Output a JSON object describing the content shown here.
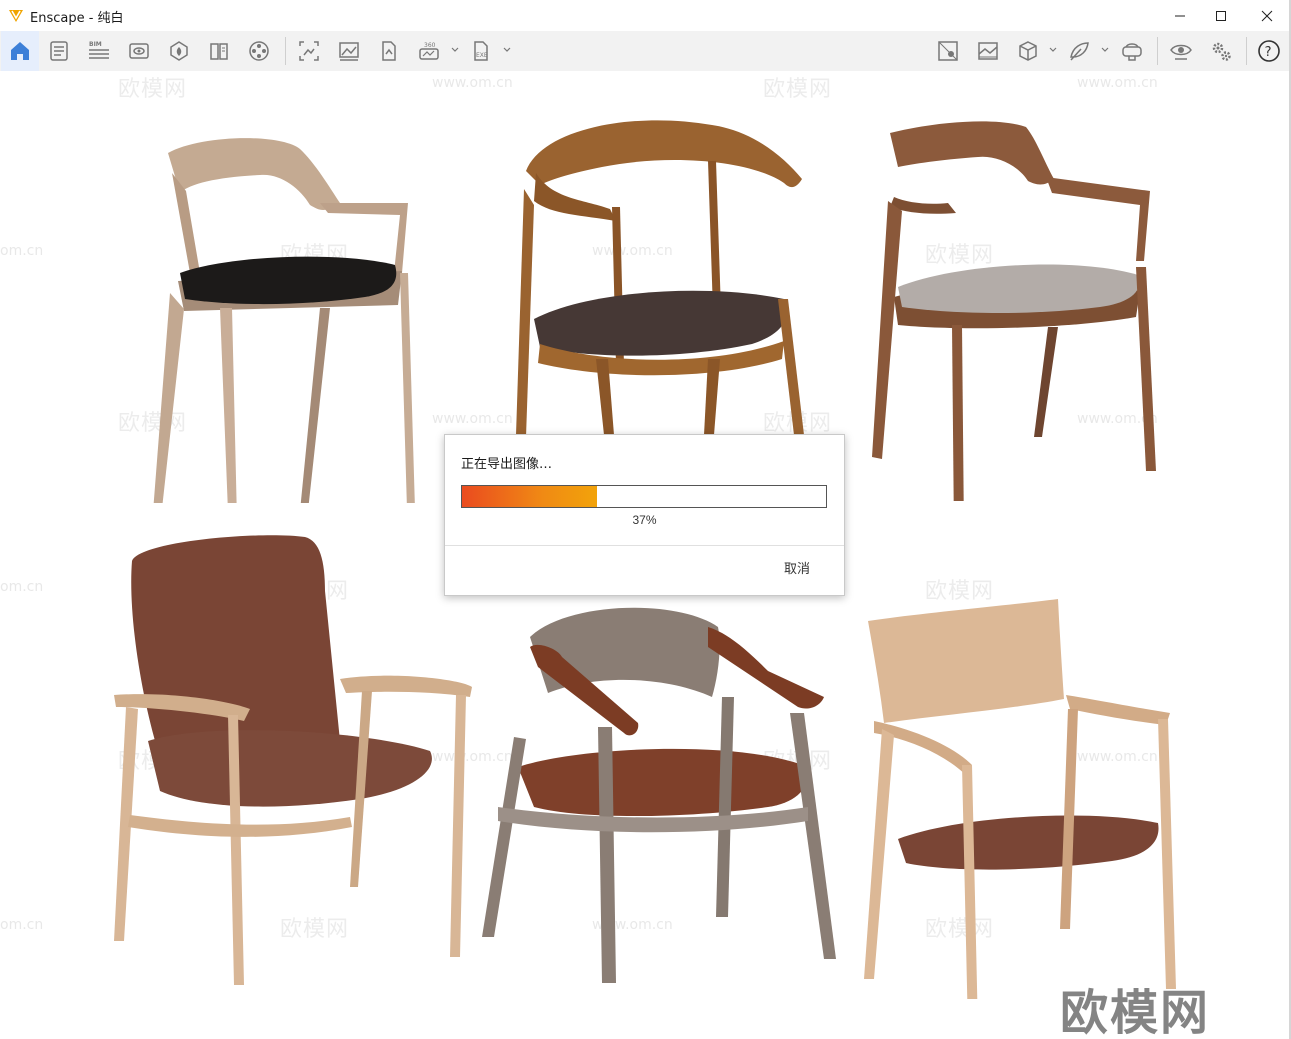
{
  "window": {
    "title": "Enscape - 纯白",
    "minimize_label": "—",
    "maximize_label": "☐",
    "close_label": "✕"
  },
  "toolbar": {
    "left_buttons": [
      {
        "icon": "home-icon"
      },
      {
        "icon": "project-notes-icon"
      },
      {
        "icon": "bim-icon",
        "badge": "BIM"
      },
      {
        "icon": "view-management-icon"
      },
      {
        "icon": "asset-library-icon"
      },
      {
        "icon": "material-editor-icon"
      },
      {
        "icon": "video-editor-icon"
      },
      {
        "icon": "screenshot-icon"
      },
      {
        "icon": "batch-render-icon"
      },
      {
        "icon": "export-icon"
      },
      {
        "icon": "panorama-360-icon",
        "badge": "360"
      },
      {
        "icon": "exe-export-icon",
        "badge": "EXE"
      }
    ],
    "right_buttons": [
      {
        "icon": "sun-position-icon"
      },
      {
        "icon": "atmosphere-icon"
      },
      {
        "icon": "view-box-icon"
      },
      {
        "icon": "feedback-icon"
      },
      {
        "icon": "vr-headset-icon"
      },
      {
        "icon": "visual-settings-icon"
      },
      {
        "icon": "settings-gears-icon"
      },
      {
        "icon": "help-icon"
      }
    ]
  },
  "watermark": {
    "brand": "欧模网",
    "url": "www.om.cn",
    "url_partial": "om.cn"
  },
  "dialog": {
    "title": "正在导出图像…",
    "progress": 0.37,
    "progress_label": "37%",
    "cancel_label": "取消"
  },
  "colors": {
    "progress_start": "#ea4b1f",
    "progress_end": "#f2a30a",
    "toolbar_bg": "#f2f2f2",
    "active_tab_bg": "#e6eefc",
    "home_icon": "#3c7fd8",
    "logo": "#f0a400"
  }
}
